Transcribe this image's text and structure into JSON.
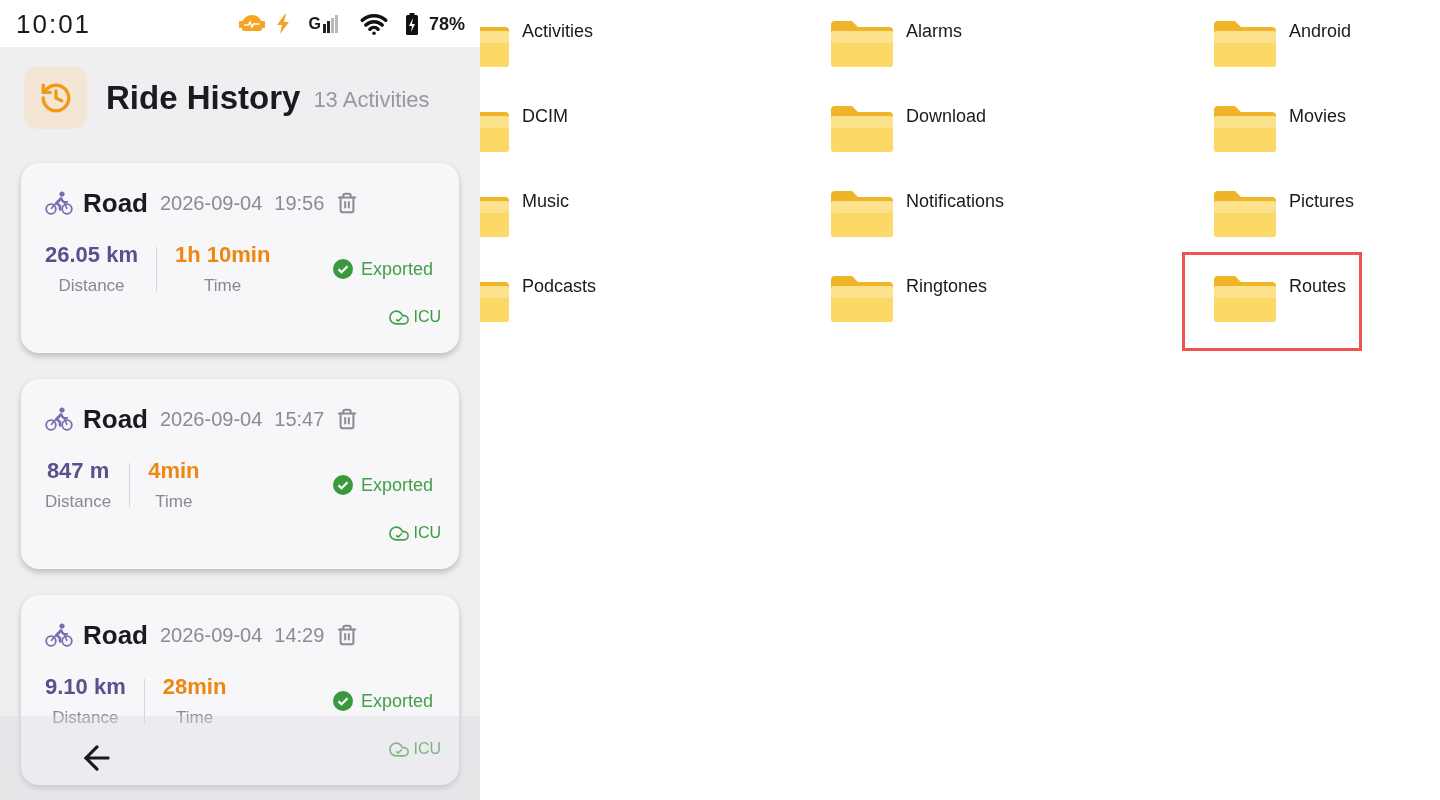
{
  "status_bar": {
    "time": "10:01",
    "network": "G",
    "battery": "78%"
  },
  "header": {
    "title": "Ride History",
    "count": "13 Activities"
  },
  "rides": [
    {
      "sport": "Road",
      "date": "2026-09-04",
      "time": "19:56",
      "distance": "26.05 km",
      "distance_label": "Distance",
      "duration": "1h 10min",
      "duration_label": "Time",
      "status": "Exported",
      "upload": "ICU"
    },
    {
      "sport": "Road",
      "date": "2026-09-04",
      "time": "15:47",
      "distance": "847 m",
      "distance_label": "Distance",
      "duration": "4min",
      "duration_label": "Time",
      "status": "Exported",
      "upload": "ICU"
    },
    {
      "sport": "Road",
      "date": "2026-09-04",
      "time": "14:29",
      "distance": "9.10 km",
      "distance_label": "Distance",
      "duration": "28min",
      "duration_label": "Time",
      "status": "Exported",
      "upload": "ICU"
    }
  ],
  "folders": [
    {
      "name": "Activities",
      "selected": false
    },
    {
      "name": "Alarms",
      "selected": false
    },
    {
      "name": "Android",
      "selected": false
    },
    {
      "name": "DCIM",
      "selected": false
    },
    {
      "name": "Download",
      "selected": false
    },
    {
      "name": "Movies",
      "selected": false
    },
    {
      "name": "Music",
      "selected": false
    },
    {
      "name": "Notifications",
      "selected": false
    },
    {
      "name": "Pictures",
      "selected": false
    },
    {
      "name": "Podcasts",
      "selected": false
    },
    {
      "name": "Ringtones",
      "selected": false
    },
    {
      "name": "Routes",
      "selected": true
    }
  ]
}
